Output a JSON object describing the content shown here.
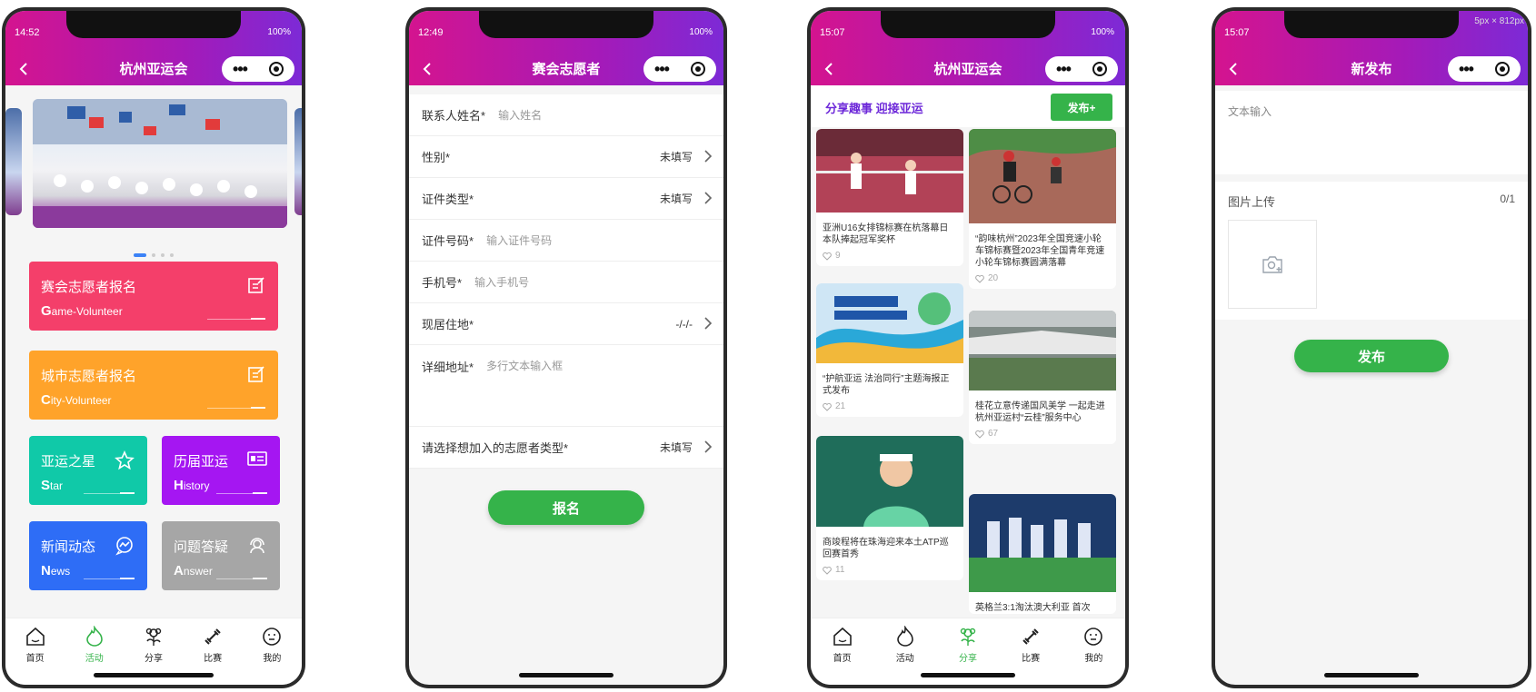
{
  "phone1": {
    "time": "14:52",
    "battery": "100%",
    "title": "杭州亚运会",
    "cards": [
      {
        "title": "赛会志愿者报名",
        "initial": "G",
        "rest": "ame-Volunteer",
        "color": "#f43f6a"
      },
      {
        "title": "城市志愿者报名",
        "initial": "C",
        "rest": "ity-Volunteer",
        "color": "#ffa32a"
      },
      {
        "title": "亚运之星",
        "initial": "S",
        "rest": "tar",
        "color": "#10c9a8"
      },
      {
        "title": "历届亚运",
        "initial": "H",
        "rest": "istory",
        "color": "#a516f2"
      },
      {
        "title": "新闻动态",
        "initial": "N",
        "rest": "ews",
        "color": "#2e6df6"
      },
      {
        "title": "问题答疑",
        "initial": "A",
        "rest": "nswer",
        "color": "#a6a6a6"
      }
    ]
  },
  "tabs": [
    "首页",
    "活动",
    "分享",
    "比赛",
    "我的"
  ],
  "phone2": {
    "time": "12:49",
    "battery": "100%",
    "title": "赛会志愿者",
    "fields": [
      {
        "label": "联系人姓名*",
        "placeholder": "输入姓名"
      },
      {
        "label": "性别*",
        "value": "未填写"
      },
      {
        "label": "证件类型*",
        "value": "未填写"
      },
      {
        "label": "证件号码*",
        "placeholder": "输入证件号码"
      },
      {
        "label": "手机号*",
        "placeholder": "输入手机号"
      },
      {
        "label": "现居住地*",
        "value": "-/-/-"
      },
      {
        "label": "详细地址*",
        "placeholder": "多行文本输入框"
      },
      {
        "label": "请选择想加入的志愿者类型*",
        "value": "未填写"
      }
    ],
    "submit": "报名"
  },
  "phone3": {
    "time": "15:07",
    "battery": "100%",
    "title": "杭州亚运会",
    "share_title": "分享趣事 迎接亚运",
    "publish": "发布+",
    "posts": [
      {
        "text": "亚洲U16女排锦标赛在杭落幕日本队捧起冠军奖杯",
        "likes": "9"
      },
      {
        "text": "“韵味杭州”2023年全国竞速小轮车锦标赛暨2023年全国青年竞速小轮车锦标赛圆满落幕",
        "likes": "20"
      },
      {
        "text": "“护航亚运 法治同行”主题海报正式发布",
        "likes": "21"
      },
      {
        "text": "桂花立意传递国风美学 一起走进杭州亚运村“云桂”服务中心",
        "likes": "67"
      },
      {
        "text": "商竣程将在珠海迎来本土ATP巡回赛首秀",
        "likes": "11"
      },
      {
        "text": "英格兰3:1淘汰澳大利亚 首次",
        "likes": ""
      }
    ]
  },
  "phone4": {
    "time": "15:07",
    "title": "新发布",
    "ruler": "5px × 812px",
    "text_input": "文本输入",
    "upload_label": "图片上传",
    "upload_count": "0/1",
    "submit": "发布"
  }
}
